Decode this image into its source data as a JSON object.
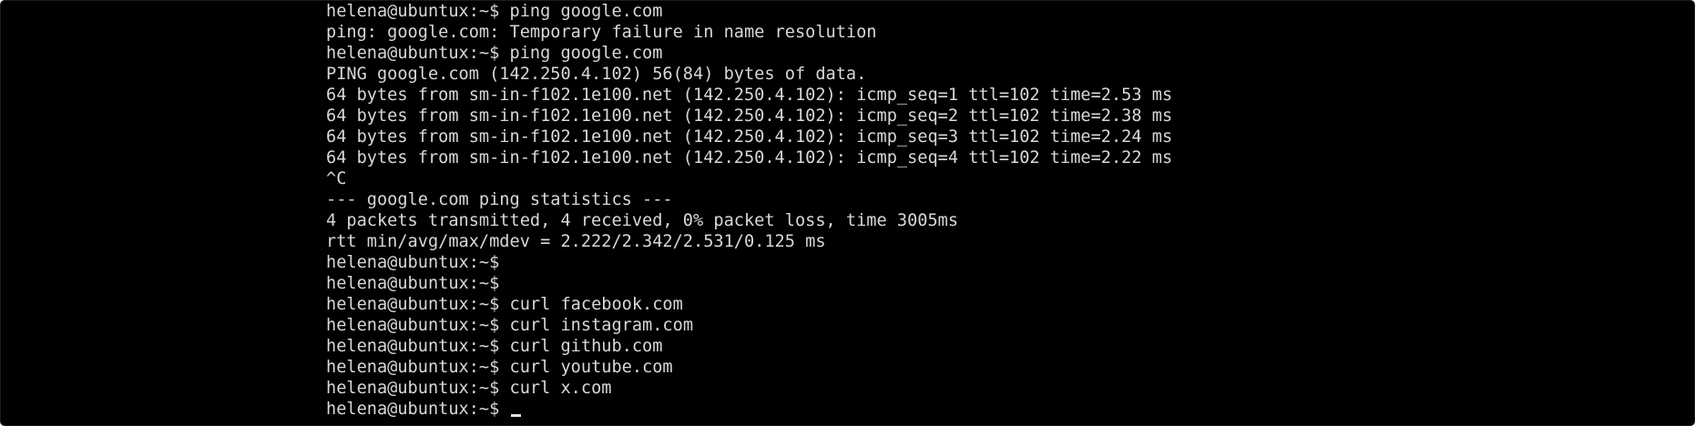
{
  "terminal": {
    "prompt": "helena@ubuntux:~$",
    "lines": [
      {
        "kind": "prompt",
        "command": "ping google.com"
      },
      {
        "kind": "output",
        "text": "ping: google.com: Temporary failure in name resolution"
      },
      {
        "kind": "prompt",
        "command": "ping google.com"
      },
      {
        "kind": "output",
        "text": "PING google.com (142.250.4.102) 56(84) bytes of data."
      },
      {
        "kind": "output",
        "text": "64 bytes from sm-in-f102.1e100.net (142.250.4.102): icmp_seq=1 ttl=102 time=2.53 ms"
      },
      {
        "kind": "output",
        "text": "64 bytes from sm-in-f102.1e100.net (142.250.4.102): icmp_seq=2 ttl=102 time=2.38 ms"
      },
      {
        "kind": "output",
        "text": "64 bytes from sm-in-f102.1e100.net (142.250.4.102): icmp_seq=3 ttl=102 time=2.24 ms"
      },
      {
        "kind": "output",
        "text": "64 bytes from sm-in-f102.1e100.net (142.250.4.102): icmp_seq=4 ttl=102 time=2.22 ms"
      },
      {
        "kind": "output",
        "text": "^C"
      },
      {
        "kind": "output",
        "text": "--- google.com ping statistics ---"
      },
      {
        "kind": "output",
        "text": "4 packets transmitted, 4 received, 0% packet loss, time 3005ms"
      },
      {
        "kind": "output",
        "text": "rtt min/avg/max/mdev = 2.222/2.342/2.531/0.125 ms"
      },
      {
        "kind": "prompt",
        "command": ""
      },
      {
        "kind": "prompt",
        "command": ""
      },
      {
        "kind": "prompt",
        "command": "curl facebook.com"
      },
      {
        "kind": "prompt",
        "command": "curl instagram.com"
      },
      {
        "kind": "prompt",
        "command": "curl github.com"
      },
      {
        "kind": "prompt",
        "command": "curl youtube.com"
      },
      {
        "kind": "prompt",
        "command": "curl x.com"
      },
      {
        "kind": "prompt",
        "command": "",
        "cursor": true
      }
    ]
  },
  "colors": {
    "background": "#000000",
    "foreground": "#d8d8d8"
  }
}
